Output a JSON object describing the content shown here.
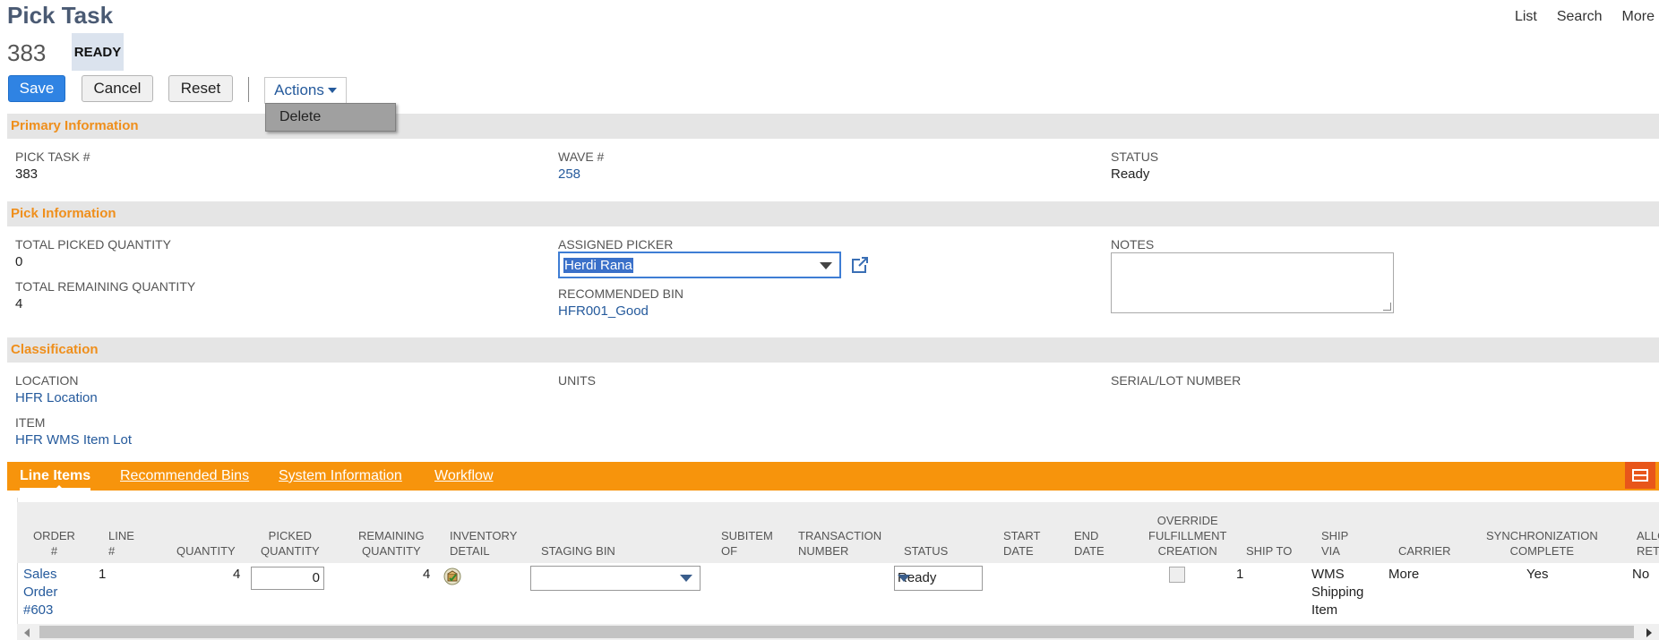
{
  "header": {
    "title": "Pick Task",
    "record_number": "383",
    "status_badge": "READY",
    "links": [
      "List",
      "Search",
      "More"
    ]
  },
  "toolbar": {
    "save_label": "Save",
    "cancel_label": "Cancel",
    "reset_label": "Reset",
    "actions_label": "Actions",
    "actions_menu": [
      "Delete"
    ]
  },
  "primary": {
    "heading": "Primary Information",
    "pick_task_label": "PICK TASK #",
    "pick_task_value": "383",
    "wave_label": "WAVE #",
    "wave_value": "258",
    "status_label": "STATUS",
    "status_value": "Ready"
  },
  "pick": {
    "heading": "Pick Information",
    "total_picked_label": "TOTAL PICKED QUANTITY",
    "total_picked_value": "0",
    "total_remaining_label": "TOTAL REMAINING QUANTITY",
    "total_remaining_value": "4",
    "assigned_picker_label": "ASSIGNED PICKER",
    "assigned_picker_value": "Herdi Rana",
    "recommended_bin_label": "RECOMMENDED BIN",
    "recommended_bin_value": "HFR001_Good",
    "notes_label": "NOTES",
    "notes_value": ""
  },
  "classification": {
    "heading": "Classification",
    "location_label": "LOCATION",
    "location_value": "HFR Location",
    "item_label": "ITEM",
    "item_value": "HFR WMS Item Lot",
    "units_label": "UNITS",
    "serial_label": "SERIAL/LOT NUMBER"
  },
  "tabs": {
    "items": [
      {
        "label": "Line Items"
      },
      {
        "label": "Recommended Bins"
      },
      {
        "label": "System Information"
      },
      {
        "label": "Workflow"
      }
    ]
  },
  "table": {
    "headers": {
      "order": [
        "ORDER",
        "#"
      ],
      "line": [
        "LINE",
        "#"
      ],
      "quantity": [
        "QUANTITY"
      ],
      "picked": [
        "PICKED",
        "QUANTITY"
      ],
      "remaining": [
        "REMAINING",
        "QUANTITY"
      ],
      "inventory": [
        "INVENTORY",
        "DETAIL"
      ],
      "staging": [
        "STAGING BIN"
      ],
      "subitem": [
        "SUBITEM",
        "OF"
      ],
      "transaction": [
        "TRANSACTION",
        "NUMBER"
      ],
      "status": [
        "STATUS"
      ],
      "start": [
        "START",
        "DATE"
      ],
      "end": [
        "END",
        "DATE"
      ],
      "override": [
        "OVERRIDE",
        "FULFILLMENT",
        "CREATION"
      ],
      "shipto": [
        "SHIP TO"
      ],
      "shipvia": [
        "SHIP",
        "VIA"
      ],
      "carrier": [
        "CARRIER"
      ],
      "sync": [
        "SYNCHRONIZATION",
        "COMPLETE"
      ],
      "allow": [
        "ALLOW",
        "RETRY"
      ]
    },
    "row": {
      "order": [
        "Sales",
        "Order",
        "#603"
      ],
      "line": "1",
      "quantity": "4",
      "picked": "0",
      "remaining": "4",
      "status": "Ready",
      "shipto": "1",
      "shipvia": [
        "WMS",
        "Shipping",
        "Item"
      ],
      "carrier": "More",
      "sync": "Yes",
      "allow": "No"
    }
  },
  "icons": {
    "external": "external-link-icon",
    "inventory": "inventory-detail-icon",
    "layout": "layout-toggle-icon"
  },
  "colors": {
    "accent_orange": "#f7940c",
    "section_heading": "#ef8f1c",
    "link_blue": "#255a9c",
    "save_blue": "#2f83e3"
  }
}
